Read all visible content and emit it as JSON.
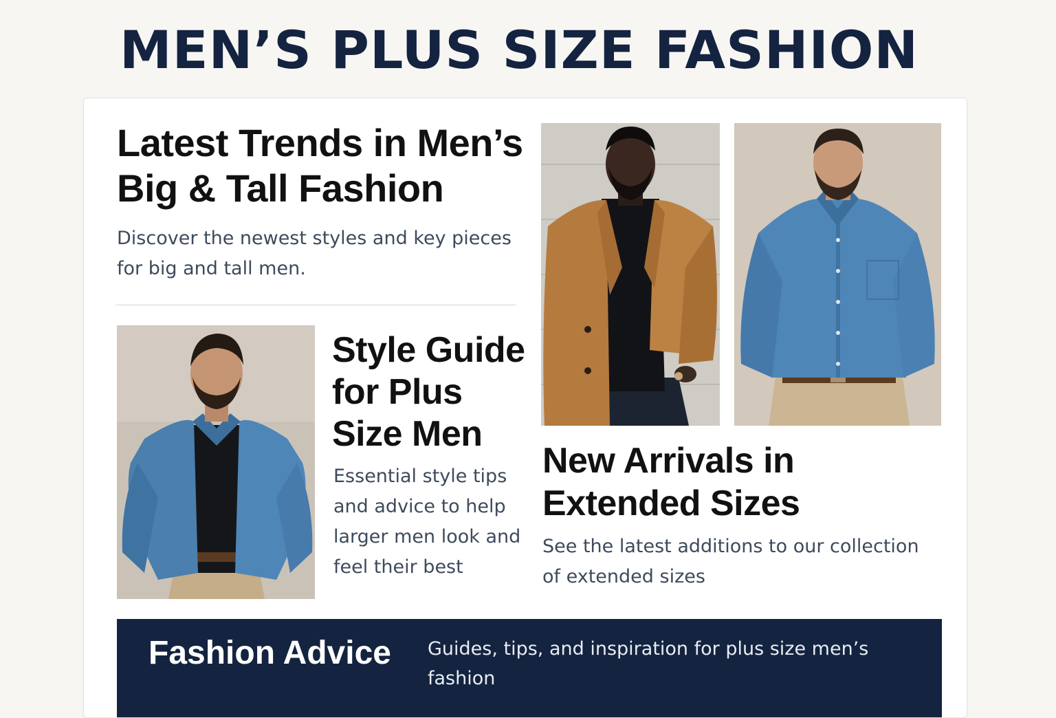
{
  "header": {
    "title": "MEN’S PLUS SIZE FASHION"
  },
  "trends": {
    "title": "Latest Trends in Men’s Big & Tall Fashion",
    "description": "Discover the newest styles and key pieces for big and tall men."
  },
  "style_guide": {
    "title": "Style Guide for Plus Size Men",
    "description": "Essential style tips and advice to help larger men look and feel their best"
  },
  "new_arrivals": {
    "title": "New Arrivals in Extended Sizes",
    "description": "See the latest additions to our collection of extended sizes"
  },
  "fashion_advice": {
    "title": "Fashion Advice",
    "description": "Guides, tips, and inspiration for plus size men’s fashion"
  },
  "colors": {
    "navy": "#14233f",
    "denim": "#4f86b8",
    "camel": "#b57a3d",
    "khaki": "#c9b28f"
  },
  "images": [
    {
      "name": "man-in-denim-overshirt-photo"
    },
    {
      "name": "man-in-camel-coat-photo"
    },
    {
      "name": "man-in-chambray-shirt-photo"
    }
  ]
}
